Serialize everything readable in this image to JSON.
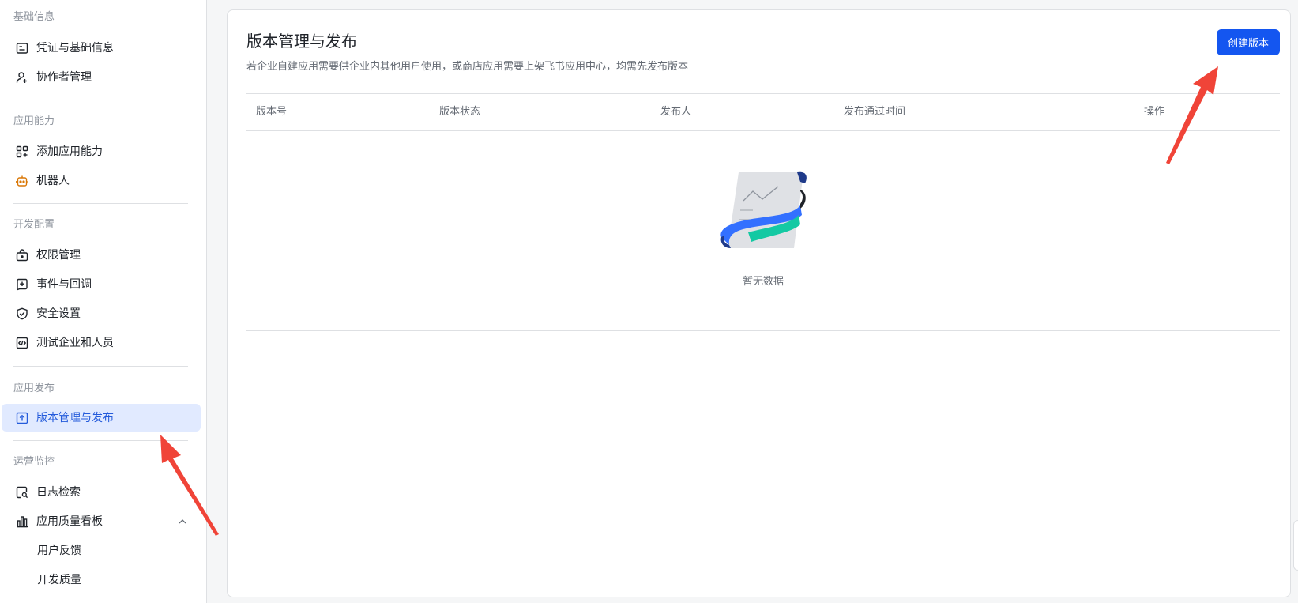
{
  "sidebar": {
    "groups": [
      {
        "title": "基础信息",
        "items": [
          {
            "label": "凭证与基础信息",
            "icon": "credential-icon"
          },
          {
            "label": "协作者管理",
            "icon": "user-add-icon"
          }
        ]
      },
      {
        "title": "应用能力",
        "items": [
          {
            "label": "添加应用能力",
            "icon": "apps-add-icon"
          },
          {
            "label": "机器人",
            "icon": "robot-icon"
          }
        ]
      },
      {
        "title": "开发配置",
        "items": [
          {
            "label": "权限管理",
            "icon": "lock-box-icon"
          },
          {
            "label": "事件与回调",
            "icon": "event-icon"
          },
          {
            "label": "安全设置",
            "icon": "shield-icon"
          },
          {
            "label": "测试企业和人员",
            "icon": "code-box-icon"
          }
        ]
      },
      {
        "title": "应用发布",
        "items": [
          {
            "label": "版本管理与发布",
            "icon": "upload-box-icon",
            "active": true
          }
        ]
      },
      {
        "title": "运营监控",
        "items": [
          {
            "label": "日志检索",
            "icon": "log-search-icon"
          },
          {
            "label": "应用质量看板",
            "icon": "bar-chart-icon"
          },
          {
            "label": "用户反馈"
          },
          {
            "label": "开发质量"
          }
        ]
      }
    ]
  },
  "main": {
    "title": "版本管理与发布",
    "description": "若企业自建应用需要供企业内其他用户使用，或商店应用需要上架飞书应用中心，均需先发布版本",
    "create_button": "创建版本",
    "table": {
      "columns": [
        "版本号",
        "版本状态",
        "发布人",
        "发布通过时间",
        "操作"
      ],
      "empty_text": "暂无数据"
    }
  },
  "colors": {
    "primary": "#1456f0",
    "active_bg": "#e1eaff",
    "active_text": "#245bdb",
    "annotation_arrow": "#f04438"
  }
}
